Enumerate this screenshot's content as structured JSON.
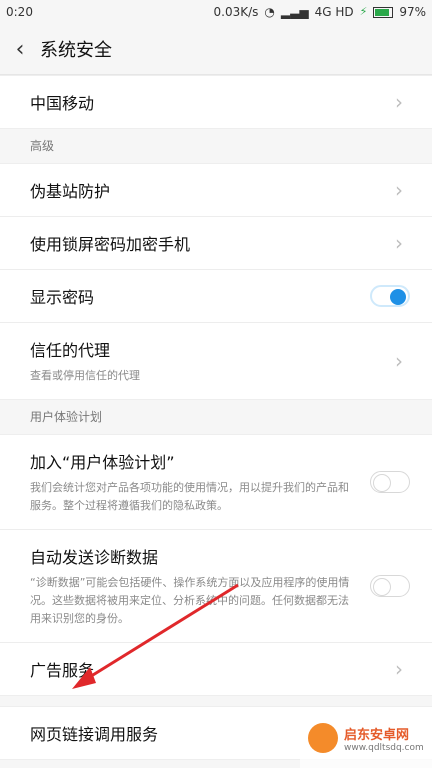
{
  "status": {
    "time": "0:20",
    "net_speed": "0.03K/s",
    "network": "4G HD",
    "battery": "97%"
  },
  "header": {
    "title": "系统安全"
  },
  "top_item": {
    "label": "中国移动"
  },
  "advanced": {
    "title": "高级",
    "items": [
      {
        "label": "伪基站防护"
      },
      {
        "label": "使用锁屏密码加密手机"
      },
      {
        "label": "显示密码"
      },
      {
        "label": "信任的代理",
        "sub": "查看或停用信任的代理"
      }
    ]
  },
  "ux_plan": {
    "title": "用户体验计划",
    "items": [
      {
        "label": "加入“用户体验计划”",
        "sub": "我们会统计您对产品各项功能的使用情况，用以提升我们的产品和服务。整个过程将遵循我们的隐私政策。"
      },
      {
        "label": "自动发送诊断数据",
        "sub": "“诊断数据”可能会包括硬件、操作系统方面以及应用程序的使用情况。这些数据将被用来定位、分析系统中的问题。任何数据都无法用来识别您的身份。"
      },
      {
        "label": "广告服务"
      }
    ]
  },
  "bottom_item": {
    "label": "网页链接调用服务"
  },
  "watermark": {
    "title": "启东安卓网",
    "url": "www.qdltsdq.com"
  },
  "colors": {
    "accent": "#1e90e6",
    "annotation": "#e0282b"
  }
}
